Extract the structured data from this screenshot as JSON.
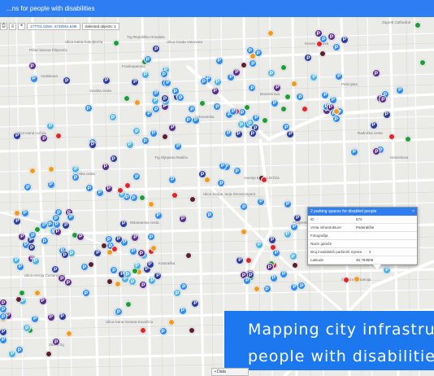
{
  "window": {
    "title": "...ns for people with disabilities"
  },
  "toolbar": {
    "coordinates": "177701.025m, 5748051.649t",
    "selected_label": "Selected objects: 1",
    "icons": [
      "print-icon",
      "layers-icon",
      "coordinates-icon"
    ]
  },
  "map_labels": [
    "Ulica Ivana Kukuljevića",
    "Prilaz baruna Filipovića",
    "Trg Republike Hrvatske",
    "Frankopanska",
    "Savska cesta",
    "Ulica Grada Vukovara",
    "Zagreb Cathedral",
    "Vodnikova",
    "Ulica Ivana Lučića",
    "Trg Stjepana Radića",
    "Kneza Mislava",
    "Avenija Marina Držića",
    "Slavonska avenija",
    "Strojarska cesta",
    "Ulica Hrvoja Ćustanovića",
    "Radnička cesta",
    "Ulica Ivana Gorana Kovačića",
    "Ulica Paškala Antulića",
    "Vukovarska",
    "Miramarska cesta",
    "Branimirova",
    "Ulica Josipa Jurja Strossmayera",
    "Koturaška",
    "Zeleni trg",
    "Savska cesta",
    "Petrinjska",
    "Heinzelova"
  ],
  "popup": {
    "title": "2 parking spaces for disabled people",
    "rows": [
      {
        "k": "ID",
        "v": "572"
      },
      {
        "k": "Vrsta infrastrukture",
        "v": "Parkiralište"
      },
      {
        "k": "Fotografija",
        "v": ""
      },
      {
        "k": "Naziv garaže",
        "v": ""
      },
      {
        "k": "Broj invalidskih parkirnih mjesta",
        "v": "2"
      },
      {
        "k": "Latitude",
        "v": "45.793506"
      }
    ]
  },
  "banner": {
    "line1": "Mapping city infrastruc",
    "line2": "people with disabilitie"
  },
  "data_tab": {
    "label": "Data"
  },
  "marker_symbol": "P",
  "colors": {
    "blue": "#2e8cf2",
    "darkblue": "#2d3e9a",
    "purple": "#5a2f8a",
    "green": "#1e9c3a",
    "red": "#e0242a",
    "maroon": "#5a1e2e",
    "orange": "#f29a1c",
    "lightblue": "#4db3e8"
  }
}
